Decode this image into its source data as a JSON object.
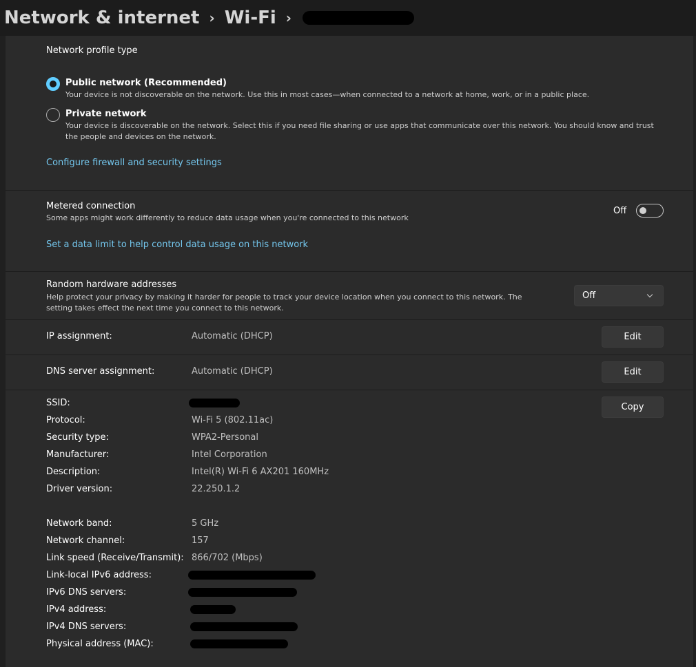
{
  "breadcrumb": {
    "parent": "Network & internet",
    "current": "Wi-Fi",
    "separator": "›"
  },
  "profile": {
    "title": "Network profile type",
    "options": [
      {
        "label": "Public network (Recommended)",
        "description": "Your device is not discoverable on the network. Use this in most cases—when connected to a network at home, work, or in a public place.",
        "selected": true
      },
      {
        "label": "Private network",
        "description": "Your device is discoverable on the network. Select this if you need file sharing or use apps that communicate over this network. You should know and trust the people and devices on the network.",
        "selected": false
      }
    ],
    "link": "Configure firewall and security settings"
  },
  "metered": {
    "title": "Metered connection",
    "description": "Some apps might work differently to reduce data usage when you're connected to this network",
    "toggle_label": "Off",
    "toggle_on": false,
    "link": "Set a data limit to help control data usage on this network"
  },
  "random_hw": {
    "title": "Random hardware addresses",
    "description": "Help protect your privacy by making it harder for people to track your device location when you connect to this network. The setting takes effect the next time you connect to this network.",
    "dropdown_value": "Off"
  },
  "ip": {
    "label": "IP assignment:",
    "value": "Automatic (DHCP)",
    "button": "Edit"
  },
  "dns": {
    "label": "DNS server assignment:",
    "value": "Automatic (DHCP)",
    "button": "Edit"
  },
  "properties": {
    "copy_button": "Copy",
    "rows": [
      {
        "label": "SSID:",
        "value": ""
      },
      {
        "label": "Protocol:",
        "value": "Wi-Fi 5 (802.11ac)"
      },
      {
        "label": "Security type:",
        "value": "WPA2-Personal"
      },
      {
        "label": "Manufacturer:",
        "value": "Intel Corporation"
      },
      {
        "label": "Description:",
        "value": "Intel(R) Wi-Fi 6 AX201 160MHz"
      },
      {
        "label": "Driver version:",
        "value": "22.250.1.2"
      },
      {
        "label": "Network band:",
        "value": "5 GHz"
      },
      {
        "label": "Network channel:",
        "value": "157"
      },
      {
        "label": "Link speed (Receive/Transmit):",
        "value": "866/702 (Mbps)"
      },
      {
        "label": "Link-local IPv6 address:",
        "value": ""
      },
      {
        "label": "IPv6 DNS servers:",
        "value": ""
      },
      {
        "label": "IPv4 address:",
        "value": ""
      },
      {
        "label": "IPv4 DNS servers:",
        "value": ""
      },
      {
        "label": "Physical address (MAC):",
        "value": ""
      }
    ]
  },
  "colors": {
    "accent": "#60cdff",
    "link": "#74c7ee",
    "background": "#202020",
    "card": "#2b2b2b"
  }
}
